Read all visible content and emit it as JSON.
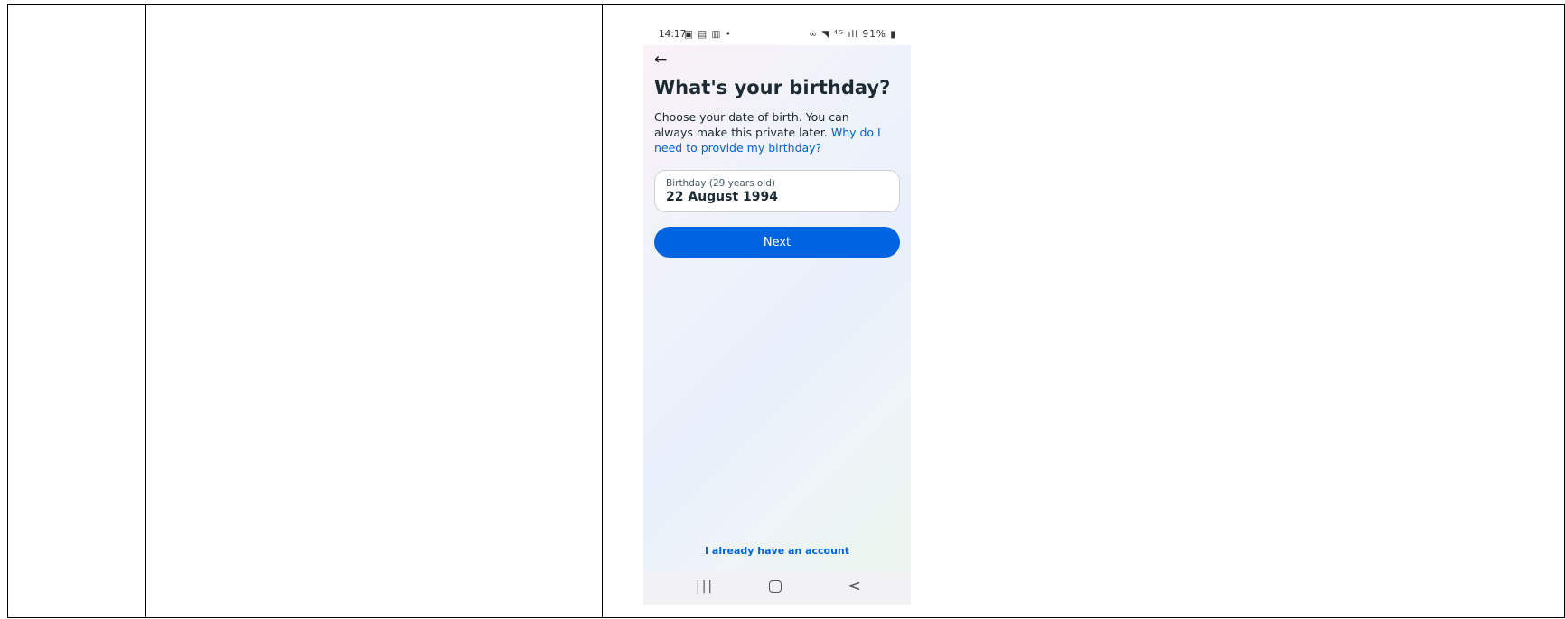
{
  "status_bar": {
    "time": "14:17",
    "left_icons": "▣ ▤ ▥ •",
    "right_icons": "∞ ◥ ⁴ᴳ ıll 91% ▮"
  },
  "screen": {
    "back_arrow": "←",
    "title": "What's your birthday?",
    "description": "Choose your date of birth. You can always make this private later.",
    "description_link": "Why do I need to provide my birthday?",
    "birthday_field": {
      "label": "Birthday (29 years old)",
      "value": "22 August 1994"
    },
    "next_button": "Next",
    "have_account_link": "I already have an account"
  },
  "nav_bar": {
    "recents": "|||",
    "back": "<"
  },
  "colors": {
    "accent": "#0064e0",
    "text": "#1c2b33"
  }
}
